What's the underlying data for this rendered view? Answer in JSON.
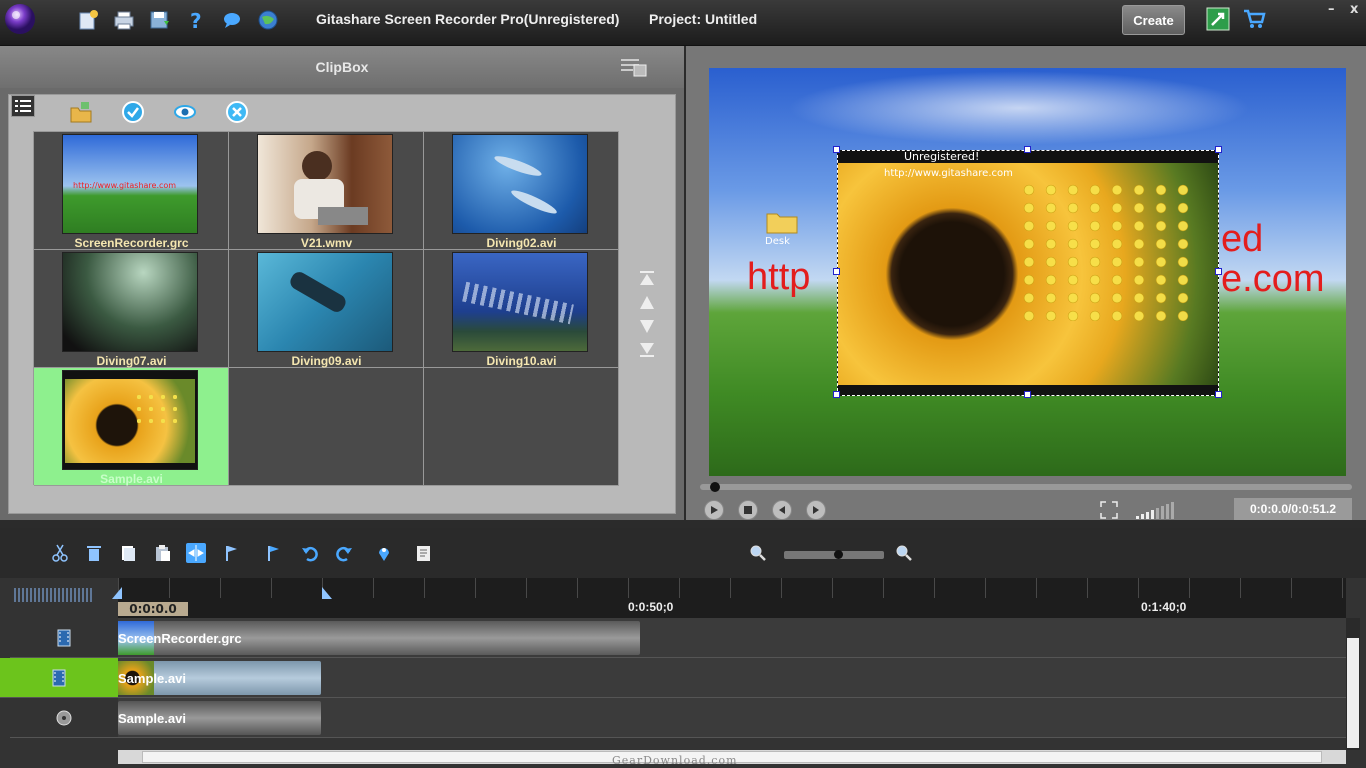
{
  "titlebar": {
    "app_title": "Gitashare Screen Recorder Pro(Unregistered)",
    "project": "Project: Untitled",
    "create_label": "Create",
    "minimize": "–",
    "close": "x",
    "icons": [
      "app-logo-icon",
      "new-project-icon",
      "print-icon",
      "save-icon",
      "help-icon",
      "chat-icon",
      "web-icon"
    ]
  },
  "clipbox": {
    "title": "ClipBox",
    "items": [
      {
        "label": "ScreenRecorder.grc",
        "thumb": "desktop"
      },
      {
        "label": "V21.wmv",
        "thumb": "woman"
      },
      {
        "label": "Diving02.avi",
        "thumb": "ocean"
      },
      {
        "label": "Diving07.avi",
        "thumb": "cave"
      },
      {
        "label": "Diving09.avi",
        "thumb": "diver"
      },
      {
        "label": "Diving10.avi",
        "thumb": "fish"
      },
      {
        "label": "Sample.avi",
        "thumb": "flower",
        "selected": true
      }
    ]
  },
  "preview": {
    "overlay_unregistered": "Unregistered!",
    "overlay_url": "http://www.gitashare.com",
    "bg_text_red_right": "ed",
    "bg_text_red_left": "http",
    "bg_text_red_right2": "e.com",
    "desktop_icon_label": "Desk",
    "timecode": "0:0:0.0/0:0:51.2"
  },
  "timeline": {
    "ruler": {
      "start": "0:0:0.0",
      "mark1": "0:0:50;0",
      "mark2": "0:1:40;0"
    },
    "tracks": [
      {
        "clip": "ScreenRecorder.grc",
        "type": "video"
      },
      {
        "clip": "Sample.avi",
        "type": "video",
        "active": true
      },
      {
        "clip": "Sample.avi",
        "type": "audio"
      }
    ]
  },
  "watermark": "GearDownload.com",
  "colors": {
    "accent_green": "#6cc41c",
    "selected_cell": "#8ef08e"
  }
}
